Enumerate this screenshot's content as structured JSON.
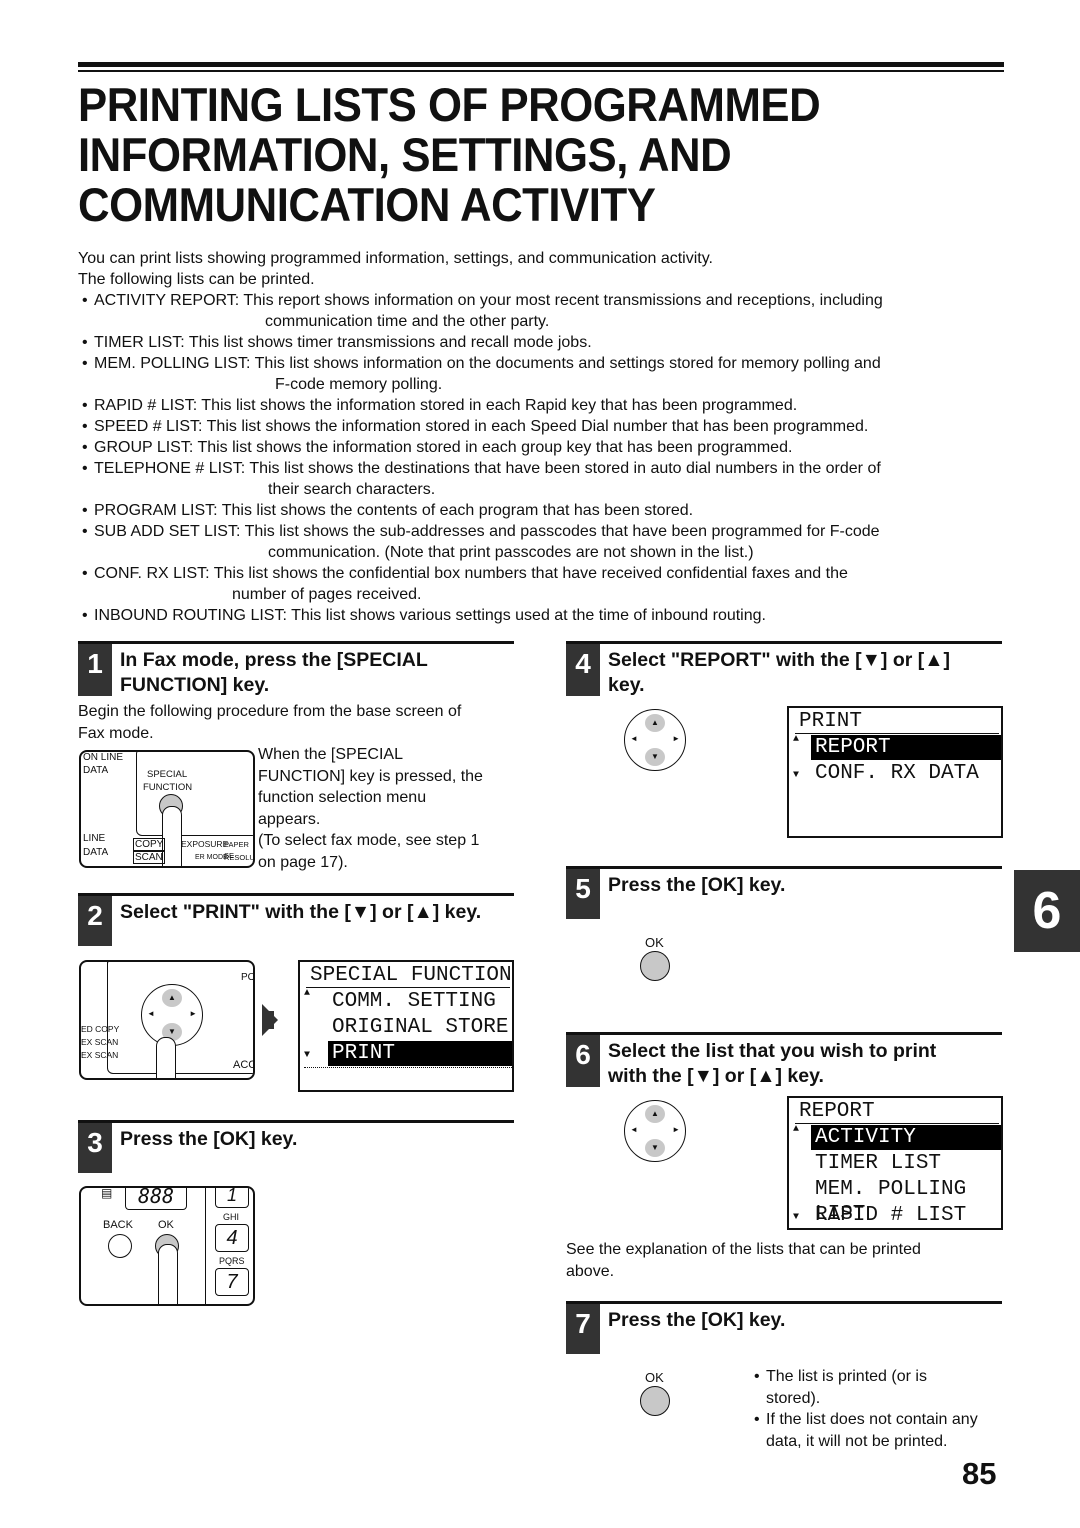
{
  "title_lines": [
    "PRINTING LISTS OF PROGRAMMED",
    "INFORMATION, SETTINGS, AND",
    "COMMUNICATION ACTIVITY"
  ],
  "intro": [
    "You can print lists showing programmed information, settings, and communication activity.",
    "The following lists can be printed."
  ],
  "lists": [
    {
      "line1": "ACTIVITY REPORT: This report shows information on your most recent transmissions and receptions, including",
      "line2": "communication time and the other party."
    },
    {
      "line1": "TIMER LIST: This list shows timer transmissions and recall mode jobs.",
      "line2": ""
    },
    {
      "line1": "MEM. POLLING LIST: This list shows information on the documents and settings stored for memory polling and",
      "line2": "F-code memory polling."
    },
    {
      "line1": "RAPID # LIST: This list shows the information stored in each Rapid key that has been programmed.",
      "line2": ""
    },
    {
      "line1": "SPEED # LIST: This list shows the information stored in each Speed Dial number that has been programmed.",
      "line2": ""
    },
    {
      "line1": "GROUP LIST: This list shows the information stored in each group key that has been programmed.",
      "line2": ""
    },
    {
      "line1": "TELEPHONE # LIST: This list shows the destinations that have been stored in auto dial numbers in the order of",
      "line2": "their search characters."
    },
    {
      "line1": "PROGRAM LIST: This list shows the contents of each program that has been stored.",
      "line2": ""
    },
    {
      "line1": "SUB ADD SET LIST: This list shows the sub-addresses and passcodes that have been programmed for F-code",
      "line2": "communication. (Note that print passcodes are not shown in the list.)"
    },
    {
      "line1": "CONF. RX LIST: This list shows the confidential box numbers that have received confidential faxes and the",
      "line2": "number of pages received."
    },
    {
      "line1": "INBOUND ROUTING LIST: This list shows various settings used at the time of inbound routing.",
      "line2": ""
    }
  ],
  "steps": {
    "s1": {
      "num": "1",
      "title_l1": "In Fax mode, press the [SPECIAL",
      "title_l2": "FUNCTION] key.",
      "body": [
        "Begin the following procedure from the base screen of",
        "Fax mode."
      ],
      "side": [
        "When the [SPECIAL",
        "FUNCTION] key is pressed, the",
        "function selection menu",
        "appears.",
        "(To select fax mode, see step 1",
        "on page 17)."
      ],
      "panel": {
        "online": "ON LINE",
        "data1": "DATA",
        "special": "SPECIAL",
        "function": "FUNCTION",
        "line": "LINE",
        "data2": "DATA",
        "copy": "COPY",
        "exposure": "EXPOSURE",
        "paper": "PAPER SE",
        "scan": "SCAN",
        "mode": "ER MODE",
        "resol": "RESOLU"
      }
    },
    "s2": {
      "num": "2",
      "title": "Select \"PRINT\" with the [▼] or [▲] key.",
      "panel": {
        "edcopy": "ED COPY",
        "exscan1": "EX SCAN",
        "exscan2": "EX SCAN",
        "po": "PO",
        "acc": "ACC"
      },
      "lcd": {
        "title": "SPECIAL FUNCTION",
        "rows": [
          "COMM. SETTING",
          "ORIGINAL STORE",
          "PRINT"
        ],
        "selected": 2
      }
    },
    "s3": {
      "num": "3",
      "title": "Press the [OK] key.",
      "panel": {
        "display": "888",
        "back": "BACK",
        "ok": "OK",
        "ghi": "GHI",
        "k4": "4",
        "pqrs": "PQRS",
        "k7": "7",
        "k1": "1"
      }
    },
    "s4": {
      "num": "4",
      "title_l1": "Select \"REPORT\" with the [▼] or [▲]",
      "title_l2": "key.",
      "lcd": {
        "title": "PRINT",
        "rows": [
          "REPORT",
          "CONF. RX DATA"
        ],
        "selected": 0
      }
    },
    "s5": {
      "num": "5",
      "title": "Press the [OK] key.",
      "ok": "OK"
    },
    "s6": {
      "num": "6",
      "title_l1": "Select the list that you wish to print",
      "title_l2": "with the [▼] or [▲] key.",
      "lcd": {
        "title": "REPORT",
        "rows": [
          "ACTIVITY REPORT",
          "TIMER LIST",
          "MEM. POLLING LIST",
          "RAPID # LIST"
        ],
        "selected": 0
      },
      "body": [
        "See the explanation of the lists that can be printed",
        "above."
      ]
    },
    "s7": {
      "num": "7",
      "title": "Press the [OK] key.",
      "ok": "OK",
      "notes": [
        {
          "l1": "The list is printed (or is",
          "l2": "stored)."
        },
        {
          "l1": "If the list does not contain any",
          "l2": "data, it will not be printed."
        }
      ]
    }
  },
  "dpad_glyphs": {
    "up": "▲",
    "down": "▼",
    "left": "◄",
    "right": "►"
  },
  "chapter_tab": "6",
  "page_number": "85"
}
